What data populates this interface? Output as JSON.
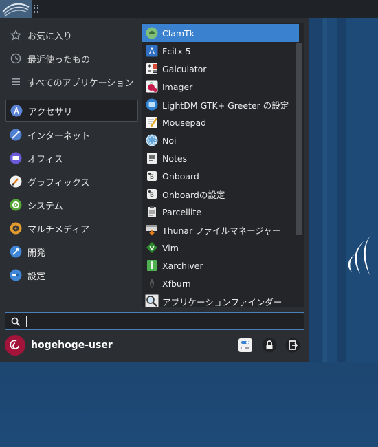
{
  "categories": [
    {
      "label": "お気に入り",
      "icon": "star-icon"
    },
    {
      "label": "最近使ったもの",
      "icon": "clock-icon"
    },
    {
      "label": "すべてのアプリケーション",
      "icon": "list-icon"
    },
    {
      "label": "アクセサリ",
      "icon": "accessories-icon",
      "selected": true
    },
    {
      "label": "インターネット",
      "icon": "internet-icon"
    },
    {
      "label": "オフィス",
      "icon": "office-icon"
    },
    {
      "label": "グラフィックス",
      "icon": "graphics-icon"
    },
    {
      "label": "システム",
      "icon": "system-icon"
    },
    {
      "label": "マルチメディア",
      "icon": "multimedia-icon"
    },
    {
      "label": "開発",
      "icon": "development-icon"
    },
    {
      "label": "設定",
      "icon": "settings-icon"
    }
  ],
  "apps": [
    {
      "label": "ClamTk",
      "icon": "clamtk-icon",
      "selected": true
    },
    {
      "label": "Fcitx 5",
      "icon": "fcitx-icon"
    },
    {
      "label": "Galculator",
      "icon": "calculator-icon"
    },
    {
      "label": "Imager",
      "icon": "raspberry-imager-icon"
    },
    {
      "label": "LightDM GTK+ Greeter の設定",
      "icon": "lightdm-icon"
    },
    {
      "label": "Mousepad",
      "icon": "text-editor-icon"
    },
    {
      "label": "Noi",
      "icon": "noi-icon"
    },
    {
      "label": "Notes",
      "icon": "notes-icon"
    },
    {
      "label": "Onboard",
      "icon": "keyboard-icon"
    },
    {
      "label": "Onboardの設定",
      "icon": "keyboard-settings-icon"
    },
    {
      "label": "Parcellite",
      "icon": "clipboard-icon"
    },
    {
      "label": "Thunar ファイルマネージャー",
      "icon": "file-manager-icon"
    },
    {
      "label": "Vim",
      "icon": "vim-icon"
    },
    {
      "label": "Xarchiver",
      "icon": "archive-icon"
    },
    {
      "label": "Xfburn",
      "icon": "disc-burner-icon"
    },
    {
      "label": "アプリケーションファインダー",
      "icon": "app-finder-icon"
    }
  ],
  "search": {
    "value": "",
    "placeholder": ""
  },
  "user": {
    "name": "hogehoge-user"
  },
  "actions": [
    "settings-icon",
    "lock-icon",
    "logout-icon"
  ],
  "colors": {
    "accent": "#3a82cf",
    "menu_bg": "#2b2e32",
    "desktop": "#1e4a78",
    "avatar": "#a3143a"
  }
}
